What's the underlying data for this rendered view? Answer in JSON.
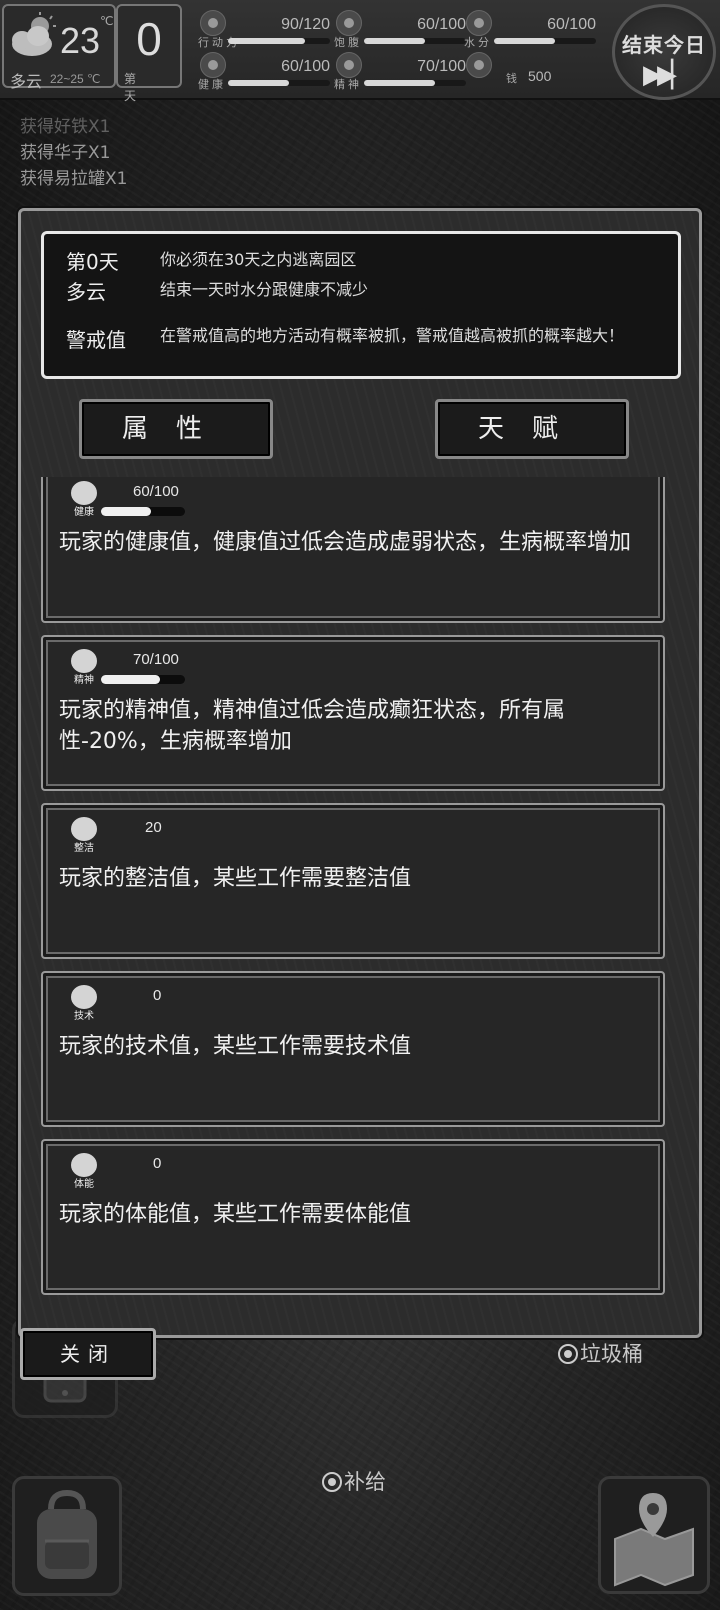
{
  "hud": {
    "temperature": "23",
    "temp_unit": "℃",
    "weather": "多云",
    "temp_range": "22~25 ℃",
    "day_number": "0",
    "day_label": "第 天",
    "stats": [
      {
        "id": "action",
        "label": "行动力",
        "value": "90/120",
        "level": 0.75,
        "icon": "footprint-icon"
      },
      {
        "id": "hunger",
        "label": "饱腹",
        "value": "60/100",
        "level": 0.6,
        "icon": "bowl-icon"
      },
      {
        "id": "water",
        "label": "水分",
        "value": "60/100",
        "level": 0.6,
        "icon": "water-drop-icon"
      },
      {
        "id": "health",
        "label": "健康",
        "value": "60/100",
        "level": 0.6,
        "icon": "health-cross-icon"
      },
      {
        "id": "spirit",
        "label": "精神",
        "value": "70/100",
        "level": 0.7,
        "icon": "brain-icon"
      },
      {
        "id": "money",
        "label": "钱",
        "value": "500",
        "icon": "money-icon"
      }
    ],
    "end_day_label": "结束今日",
    "end_day_icon": "▶▶|"
  },
  "log": [
    "获得好铁X1",
    "获得华子X1",
    "获得易拉罐X1"
  ],
  "info": {
    "rows": [
      {
        "key": "第0天",
        "value": "你必须在30天之内逃离园区"
      },
      {
        "key": "多云",
        "value": "结束一天时水分跟健康不减少"
      },
      {
        "key": "警戒值",
        "value": "在警戒值高的地方活动有概率被抓，警戒值越高被抓的概率越大！"
      }
    ]
  },
  "tabs": {
    "attributes": "属性",
    "talents": "天赋"
  },
  "attributes": [
    {
      "name": "健康",
      "icon": "health-icon",
      "value": "60/100",
      "level": 0.6,
      "has_bar": true,
      "desc": "玩家的健康值，健康值过低会造成虚弱状态，生病概率增加"
    },
    {
      "name": "精神",
      "icon": "brain-icon",
      "value": "70/100",
      "level": 0.7,
      "has_bar": true,
      "desc": "玩家的精神值，精神值过低会造成癫狂状态，所有属性-20%，生病概率增加"
    },
    {
      "name": "整洁",
      "icon": "clean-icon",
      "value": "20",
      "has_bar": false,
      "desc": "玩家的整洁值，某些工作需要整洁值"
    },
    {
      "name": "技术",
      "icon": "gear-icon",
      "value": "0",
      "has_bar": false,
      "desc": "玩家的技术值，某些工作需要技术值"
    },
    {
      "name": "体能",
      "icon": "muscle-icon",
      "value": "0",
      "has_bar": false,
      "desc": "玩家的体能值，某些工作需要体能值"
    }
  ],
  "close_label": "关闭",
  "world": {
    "trash_label": "垃圾桶",
    "supply_label": "补给"
  },
  "colors": {
    "accent": "#e8e8e8",
    "panel": "#2c2c2c",
    "alert_dot": "#b32020"
  }
}
